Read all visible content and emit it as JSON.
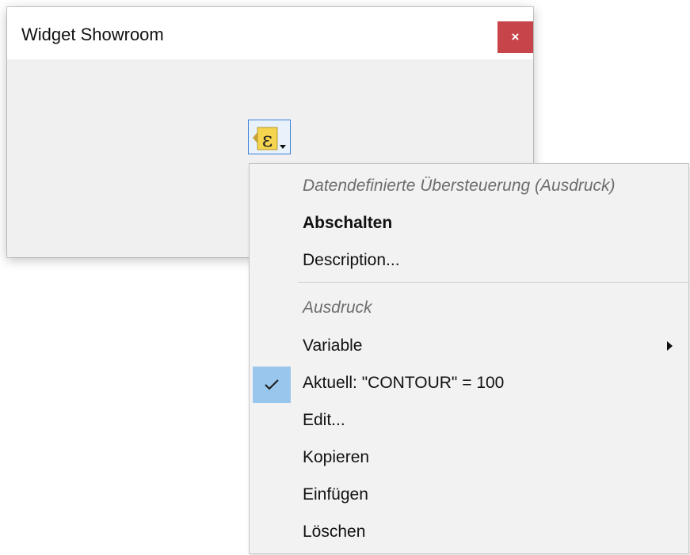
{
  "window": {
    "title": "Widget Showroom",
    "close_label": "×"
  },
  "data_defined_button": {
    "icon": "expression-epsilon-icon",
    "icon_glyph": "ε"
  },
  "menu": {
    "header_override": "Datendefinierte Übersteuerung (Ausdruck)",
    "deactivate": "Abschalten",
    "description": "Description...",
    "header_expression": "Ausdruck",
    "variable": "Variable",
    "current": "Aktuell: \"CONTOUR\"  = 100",
    "current_checked": true,
    "edit": "Edit...",
    "copy": "Kopieren",
    "paste": "Einfügen",
    "delete": "Löschen"
  },
  "colors": {
    "close_button": "#c8444b",
    "check_highlight": "#99c6ec",
    "button_border": "#3c7fd6",
    "icon_yellow": "#f5d44f"
  }
}
